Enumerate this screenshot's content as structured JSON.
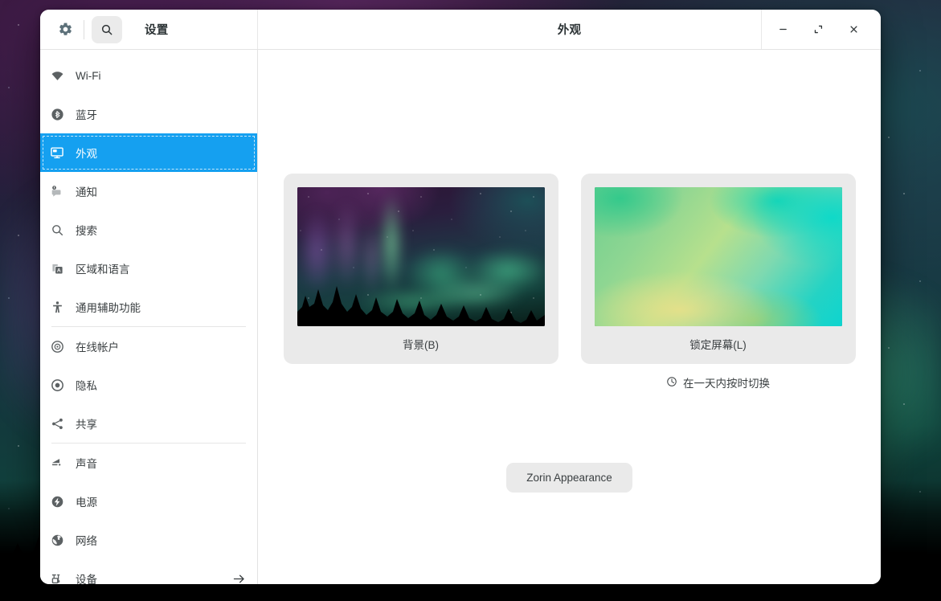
{
  "window": {
    "headerbar": {
      "gear_icon": "gear-icon",
      "search_icon": "search-icon",
      "sidebar_title": "设置",
      "main_title": "外观",
      "minimize_label": "最小化",
      "maximize_label": "最大化",
      "close_label": "关闭"
    },
    "sidebar": {
      "groups": [
        {
          "items": [
            {
              "icon": "wifi-icon",
              "label": "Wi-Fi",
              "selected": false
            },
            {
              "icon": "bluetooth-icon",
              "label": "蓝牙",
              "selected": false
            },
            {
              "icon": "display-icon",
              "label": "外观",
              "selected": true
            },
            {
              "icon": "notifications-icon",
              "label": "通知",
              "selected": false
            },
            {
              "icon": "search-icon",
              "label": "搜索",
              "selected": false
            },
            {
              "icon": "region-language-icon",
              "label": "区域和语言",
              "selected": false
            },
            {
              "icon": "accessibility-icon",
              "label": "通用辅助功能",
              "selected": false
            }
          ]
        },
        {
          "items": [
            {
              "icon": "online-accounts-icon",
              "label": "在线帐户",
              "selected": false
            },
            {
              "icon": "privacy-icon",
              "label": "隐私",
              "selected": false
            },
            {
              "icon": "sharing-icon",
              "label": "共享",
              "selected": false
            }
          ]
        },
        {
          "items": [
            {
              "icon": "sound-icon",
              "label": "声音",
              "selected": false
            },
            {
              "icon": "power-icon",
              "label": "电源",
              "selected": false
            },
            {
              "icon": "network-icon",
              "label": "网络",
              "selected": false
            },
            {
              "icon": "devices-icon",
              "label": "设备",
              "selected": false,
              "arrow": "arrow-right-icon"
            }
          ]
        }
      ]
    },
    "content": {
      "cards": [
        {
          "name": "background",
          "caption": "背景(B)",
          "thumb": "aurora-forest-photo"
        },
        {
          "name": "lock-screen",
          "caption": "锁定屏幕(L)",
          "thumb": "green-cyan-gradient"
        }
      ],
      "switch_note": {
        "icon": "clock-icon",
        "label": "在一天内按时切换"
      },
      "zorin_button": "Zorin Appearance"
    }
  },
  "colors": {
    "accent": "#15a0f0",
    "card_bg": "#eaeaea",
    "text": "#3a3f41",
    "window_bg": "#ffffff"
  }
}
